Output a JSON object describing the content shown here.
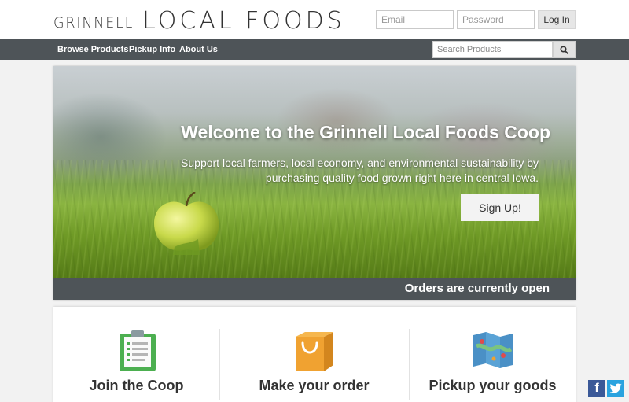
{
  "brand": {
    "word1": "GRINNELL",
    "word2": "LOCAL FOODS"
  },
  "login": {
    "email_placeholder": "Email",
    "password_placeholder": "Password",
    "button": "Log In"
  },
  "nav": {
    "items": [
      "Browse Products",
      "Pickup Info",
      "About Us"
    ],
    "search_placeholder": "Search Products",
    "search_icon": "search-icon"
  },
  "hero": {
    "title": "Welcome to the Grinnell Local Foods Coop",
    "subtitle_line1": "Support local farmers, local economy, and environmental sustainability by",
    "subtitle_line2": "purchasing quality food grown right here in central Iowa.",
    "cta": "Sign Up!",
    "status": "Orders are currently open"
  },
  "features": [
    {
      "label": "Join the Coop",
      "icon": "clipboard-icon"
    },
    {
      "label": "Make your order",
      "icon": "shopping-bag-icon"
    },
    {
      "label": "Pickup your goods",
      "icon": "map-icon"
    }
  ],
  "social": {
    "facebook": "f",
    "twitter": "t"
  },
  "colors": {
    "navbar": "#4e5458",
    "facebook": "#3b5998",
    "twitter": "#2aa3df",
    "clipboard": "#4caf50",
    "bag": "#f0a231"
  }
}
